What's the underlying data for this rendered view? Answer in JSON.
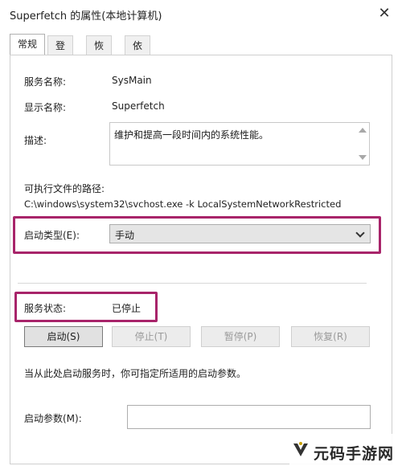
{
  "window": {
    "title": "Superfetch 的属性(本地计算机)",
    "close_glyph": "✕"
  },
  "tabs": [
    {
      "label": "常规",
      "active": true
    },
    {
      "label": "登录"
    },
    {
      "label": "恢复"
    },
    {
      "label": "依存关系"
    }
  ],
  "general": {
    "service_name_label": "服务名称:",
    "service_name_value": "SysMain",
    "display_name_label": "显示名称:",
    "display_name_value": "Superfetch",
    "description_label": "描述:",
    "description_value": "维护和提高一段时间内的系统性能。",
    "exe_path_label": "可执行文件的路径:",
    "exe_path_value": "C:\\windows\\system32\\svchost.exe -k LocalSystemNetworkRestricted",
    "startup_type_label": "启动类型(E):",
    "startup_type_value": "手动",
    "service_status_label": "服务状态:",
    "service_status_value": "已停止",
    "buttons": {
      "start": "启动(S)",
      "stop": "停止(T)",
      "pause": "暂停(P)",
      "resume": "恢复(R)"
    },
    "hint": "当从此处启动服务时，你可指定所适用的启动参数。",
    "start_params_label": "启动参数(M):",
    "start_params_value": ""
  },
  "colors": {
    "highlight": "#a8246a"
  },
  "watermark": {
    "text": "元码手游网"
  }
}
